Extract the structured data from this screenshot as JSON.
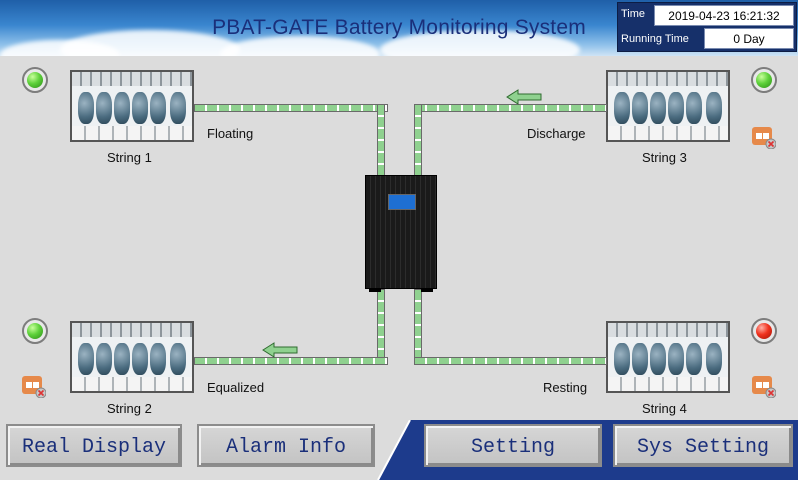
{
  "header": {
    "title": "PBAT-GATE Battery Monitoring System",
    "time_label": "Time",
    "time_value": "2019-04-23 16:21:32",
    "running_label": "Running Time",
    "running_value": "0  Day"
  },
  "strings": [
    {
      "name": "String 1",
      "status": "Floating",
      "led": "green"
    },
    {
      "name": "String 2",
      "status": "Equalized",
      "led": "green"
    },
    {
      "name": "String 3",
      "status": "Discharge",
      "led": "green"
    },
    {
      "name": "String 4",
      "status": "Resting",
      "led": "red"
    }
  ],
  "nav": {
    "real_display": "Real Display",
    "alarm_info": "Alarm Info",
    "setting": "Setting",
    "sys_setting": "Sys Setting"
  },
  "colors": {
    "header_title": "#1a2f7a",
    "bottom_bar": "#1d3b8c",
    "flow_green": "#8fd18f",
    "led_green": "#5ed13a",
    "led_red": "#f0321e"
  },
  "icons": [
    "status-led-icon",
    "battery-string-icon",
    "ups-cabinet-icon",
    "flow-arrow-icon",
    "disconnected-plug-icon"
  ]
}
